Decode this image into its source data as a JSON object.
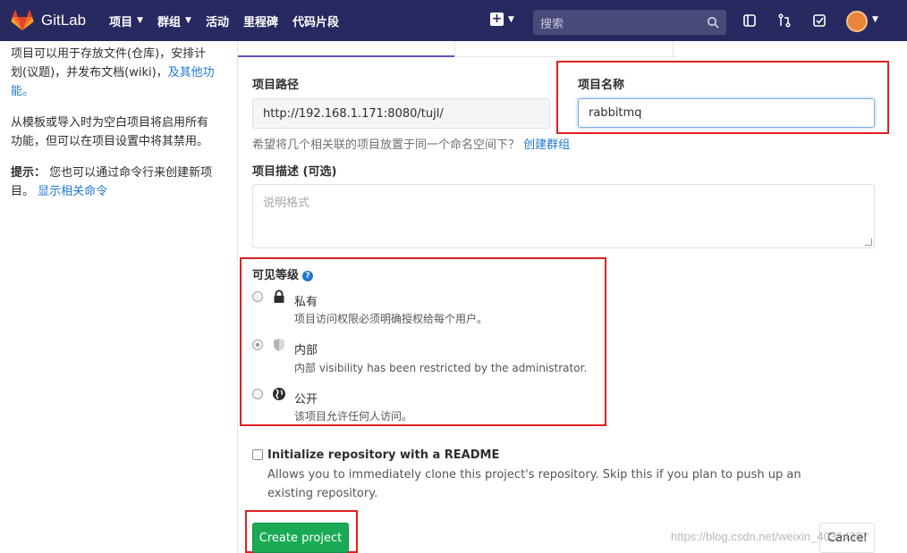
{
  "header": {
    "brand": "GitLab",
    "nav": [
      {
        "label": "项目",
        "has_caret": true
      },
      {
        "label": "群组",
        "has_caret": true
      },
      {
        "label": "活动",
        "has_caret": false
      },
      {
        "label": "里程碑",
        "has_caret": false
      },
      {
        "label": "代码片段",
        "has_caret": false
      }
    ],
    "search_placeholder": "搜索",
    "icons": [
      "plus-square-icon",
      "search-icon",
      "sidebar-toggle-icon",
      "merge-request-icon",
      "todo-check-icon",
      "user-avatar"
    ]
  },
  "left": {
    "para1": "项目可以用于存放文件(仓库)，安排计划(议题)，并发布文档(wiki)，",
    "para1_link": "及其他功能。",
    "para2": "从模板或导入时为空白项目将启用所有功能，但可以在项目设置中将其禁用。",
    "tip_label": "提示：",
    "tip_text": "您也可以通过命令行来创建新项目。",
    "tip_link": "显示相关命令"
  },
  "form": {
    "path_label": "项目路径",
    "path_value": "http://192.168.1.171:8080/tujl/",
    "name_label": "项目名称",
    "name_value": "rabbitmq",
    "group_hint": "希望将几个相关联的项目放置于同一个命名空间下？",
    "group_link": "创建群组",
    "desc_label": "项目描述 (可选)",
    "desc_placeholder": "说明格式",
    "visibility_label": "可见等级",
    "visibility": [
      {
        "title": "私有",
        "desc": "项目访问权限必须明确授权给每个用户。",
        "icon": "lock-icon",
        "checked": false
      },
      {
        "title": "内部",
        "desc": "内部 visibility has been restricted by the administrator.",
        "icon": "shield-icon",
        "checked": true
      },
      {
        "title": "公开",
        "desc": "该项目允许任何人访问。",
        "icon": "globe-icon",
        "checked": false
      }
    ],
    "init_label": "Initialize repository with a README",
    "init_desc": "Allows you to immediately clone this project's repository. Skip this if you plan to push up an existing repository.",
    "create_button": "Create project",
    "cancel_button": "Cancel"
  },
  "watermark": "https://blog.csdn.net/weixin_40304387",
  "colors": {
    "header_bg": "#292961",
    "accent_link": "#1f78d1",
    "create_green": "#1aaa55",
    "highlight_red": "#e02020"
  }
}
